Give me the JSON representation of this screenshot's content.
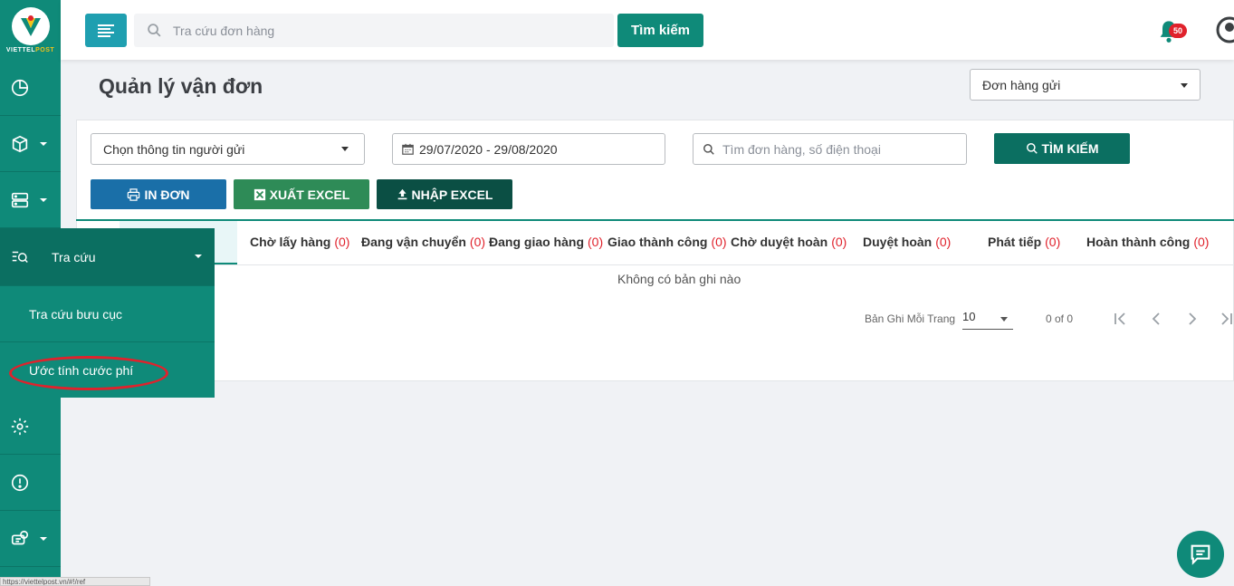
{
  "brand": {
    "logo_main": "VIETTEL",
    "logo_sub": "POST"
  },
  "header": {
    "search_placeholder": "Tra cứu đơn hàng",
    "search_button": "Tìm kiếm",
    "notification_count": "50"
  },
  "page": {
    "title": "Quản lý vận đơn",
    "order_type_select": "Đơn hàng gửi"
  },
  "filters": {
    "sender_select": "Chọn thông tin người gửi",
    "date_range": "29/07/2020 - 29/08/2020",
    "search_placeholder": "Tìm đơn hàng, số điện thoại",
    "search_button": "TÌM KIẾM"
  },
  "actions": {
    "print": "IN ĐƠN",
    "export_excel": "XUẤT EXCEL",
    "import_excel": "NHẬP EXCEL"
  },
  "tabs": [
    {
      "label": "Chờ lấy hàng",
      "count": "(0)"
    },
    {
      "label": "Đang vận chuyển",
      "count": "(0)"
    },
    {
      "label": "Đang giao hàng",
      "count": "(0)"
    },
    {
      "label": "Giao thành công",
      "count": "(0)"
    },
    {
      "label": "Chờ duyệt hoàn",
      "count": "(0)"
    },
    {
      "label": "Duyệt hoàn",
      "count": "(0)"
    },
    {
      "label": "Phát tiếp",
      "count": "(0)"
    },
    {
      "label": "Hoàn thành công",
      "count": "(0)"
    }
  ],
  "table": {
    "empty_message": "Không có bản ghi nào"
  },
  "pagination": {
    "page_size_label": "Bản Ghi Mỗi Trang",
    "page_size": "10",
    "range": "0 of 0"
  },
  "flyout": {
    "title": "Tra cứu",
    "items": [
      "Tra cứu bưu cục",
      "Ước tính cước phí"
    ]
  },
  "status_bar": {
    "url": "https://viettelpost.vn/#!/ref"
  },
  "colors": {
    "primary": "#0f8a79",
    "menu_button": "#1f9fb0",
    "print_button": "#1a6fa8",
    "export_button": "#2e8b57",
    "import_button": "#0b4f44",
    "badge": "#e0222c"
  }
}
